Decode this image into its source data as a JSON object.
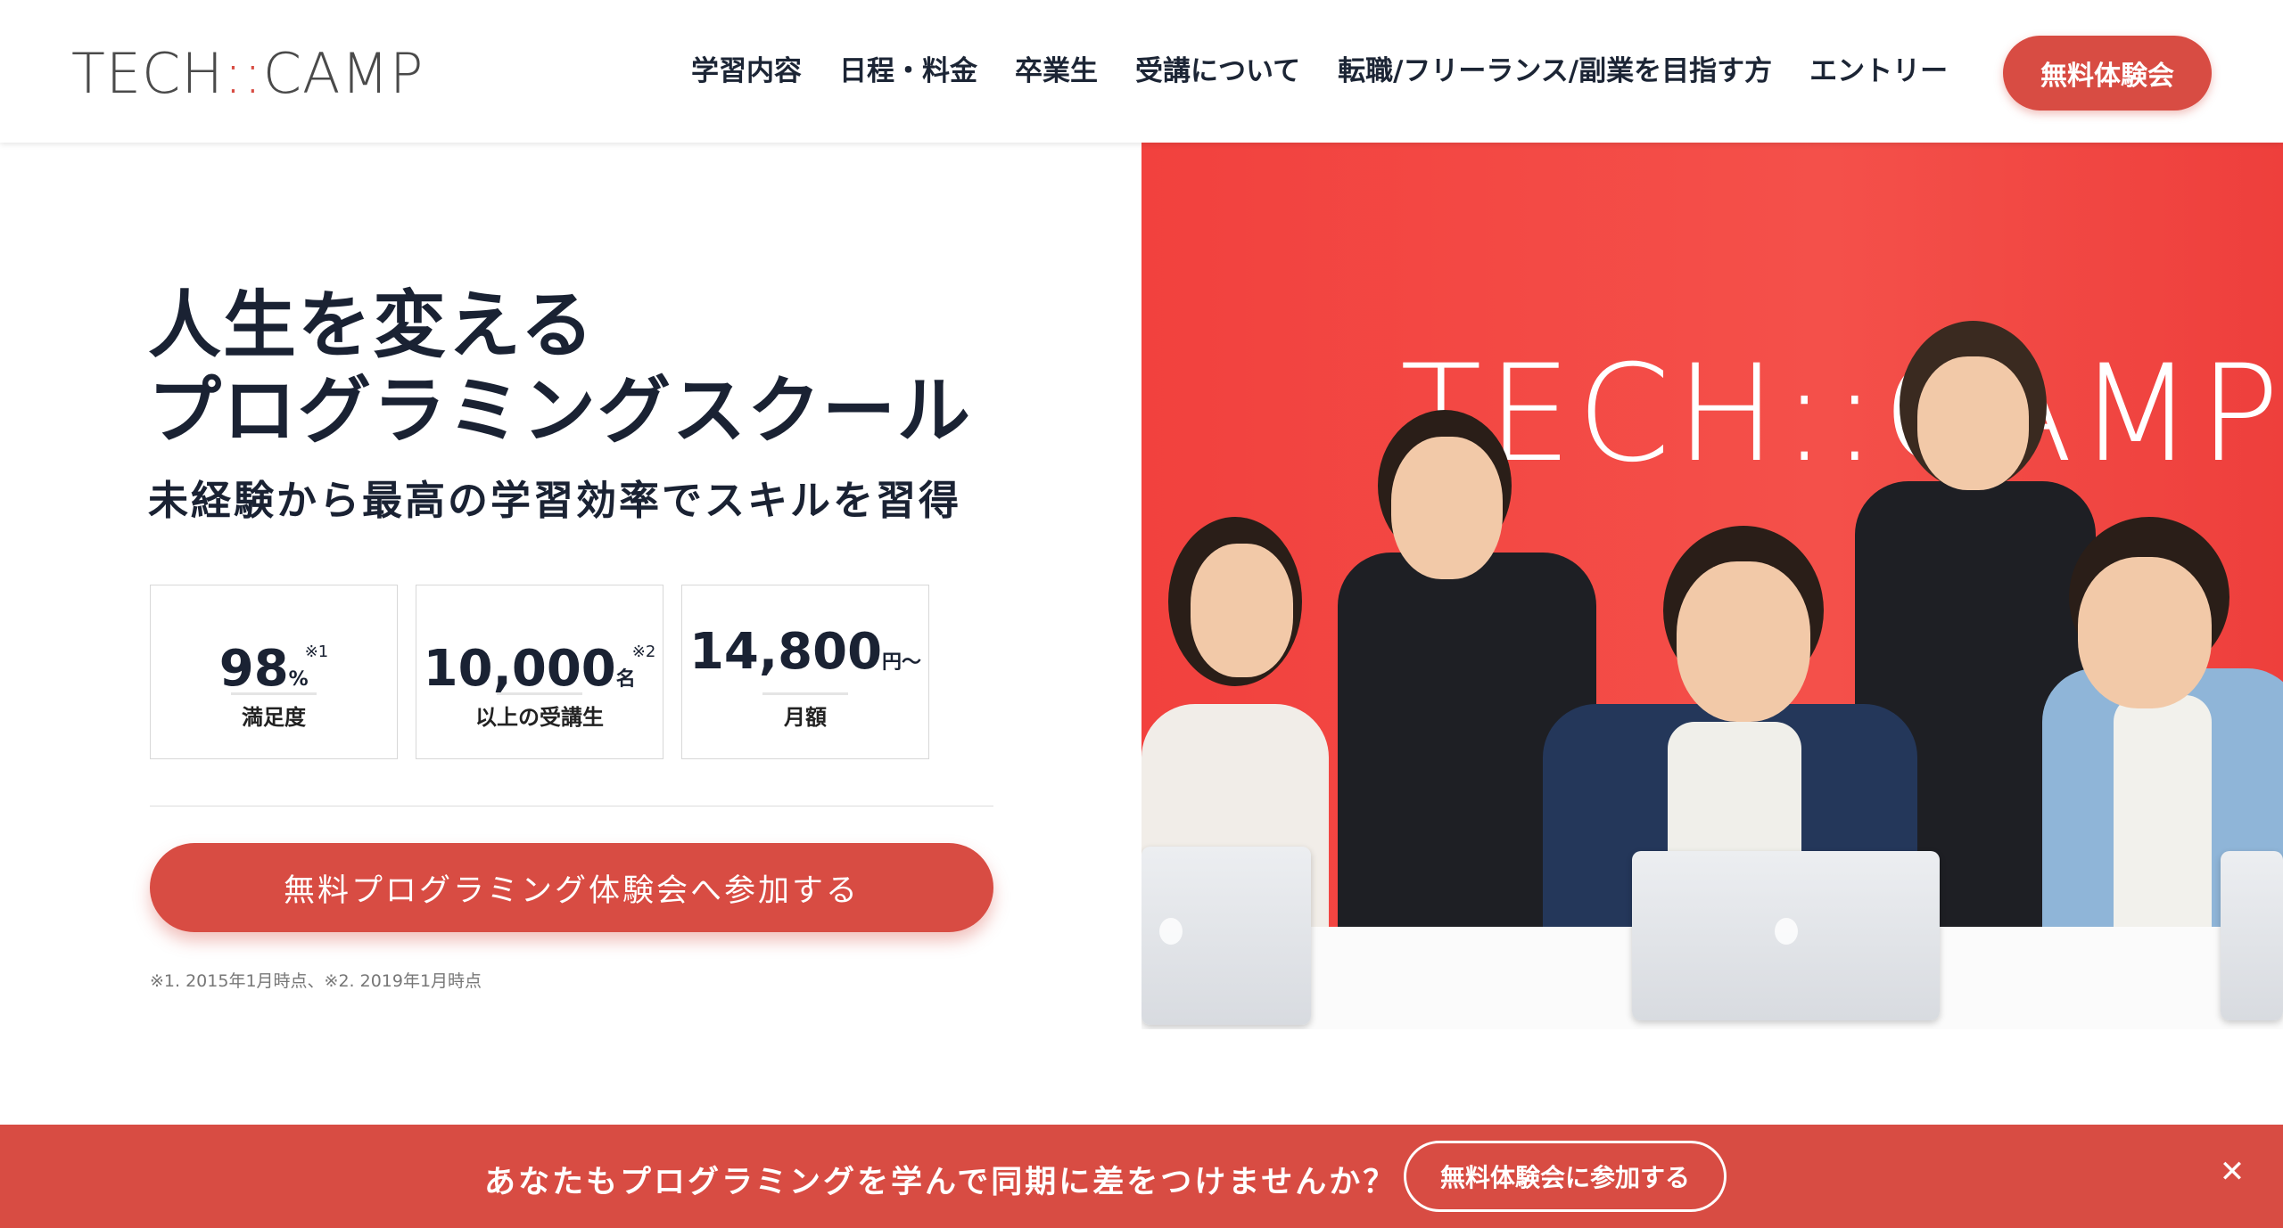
{
  "brand": {
    "logo_left": "TECH",
    "logo_sep": "::",
    "logo_right": "CAMP",
    "accent_color": "#d84c43"
  },
  "nav": {
    "items": [
      "学習内容",
      "日程・料金",
      "卒業生",
      "受講について",
      "転職/フリーランス/副業を目指す方",
      "エントリー"
    ],
    "cta_label": "無料体験会"
  },
  "hero": {
    "title_line1": "人生を変える",
    "title_line2": "プログラミングスクール",
    "subtitle": "未経験から最高の学習効率でスキルを習得",
    "stats": [
      {
        "value": "98",
        "unit": "%",
        "note": "※1",
        "label": "満足度"
      },
      {
        "value": "10,000",
        "unit": "名",
        "note": "※2",
        "label": "以上の受講生"
      },
      {
        "value": "14,800",
        "unit": "円〜",
        "note": "",
        "label": "月額"
      }
    ],
    "cta_label": "無料プログラミング体験会へ参加する",
    "footnote": "※1. 2015年1月時点、※2. 2019年1月時点"
  },
  "photo": {
    "wall_logo": "TECH::CAMP"
  },
  "banner": {
    "text": "あなたもプログラミングを学んで同期に差をつけませんか？",
    "cta_label": "無料体験会に参加する",
    "close_icon": "close-icon"
  }
}
